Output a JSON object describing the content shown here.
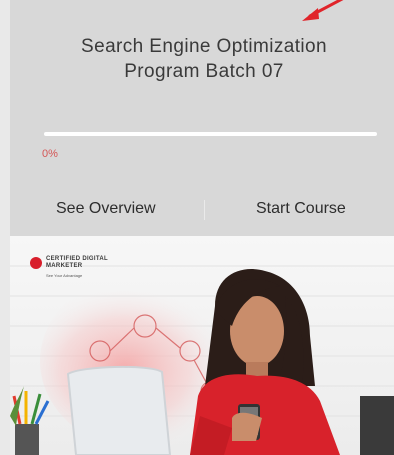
{
  "course": {
    "title_line1": "Search Engine Optimization",
    "title_line2": "Program Batch 07",
    "progress_percent": 0,
    "progress_label": "0%"
  },
  "actions": {
    "overview_label": "See Overview",
    "start_label": "Start Course"
  },
  "banner": {
    "brand_line1": "CERTIFIED DIGITAL",
    "brand_line2": "MARKETER",
    "brand_tagline": "See Your Advantage"
  },
  "colors": {
    "accent": "#d81e2b",
    "progress_label": "#d45656",
    "card_bg": "#d8d8d8"
  }
}
